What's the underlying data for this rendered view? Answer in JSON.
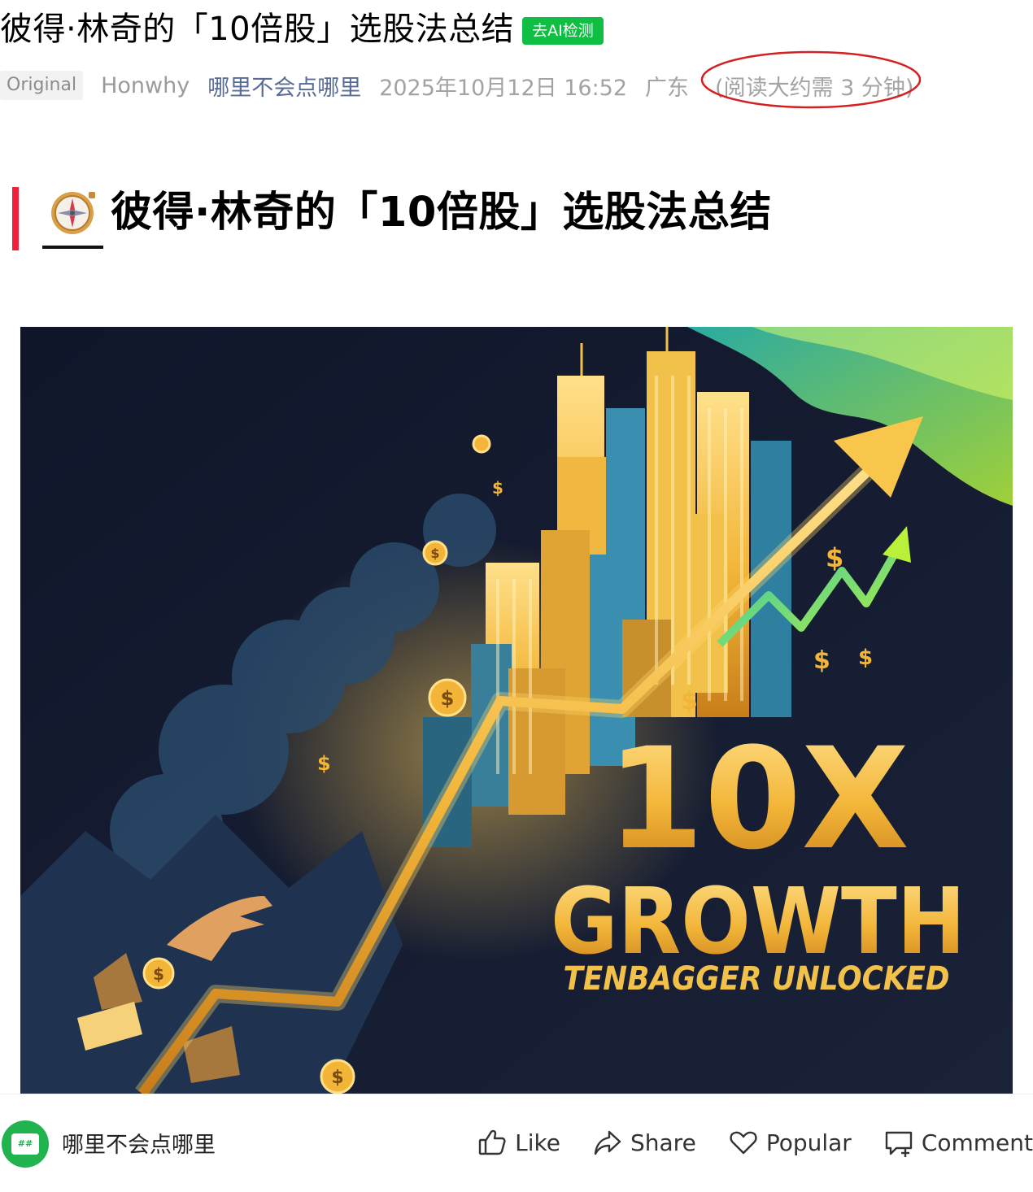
{
  "article": {
    "title": "彼得·林奇的「10倍股」选股法总结",
    "ai_badge": "去AI检测"
  },
  "meta": {
    "original_badge": "Original",
    "author": "Honwhy",
    "account_name": "哪里不会点哪里",
    "publish_time": "2025年10月12日 16:52",
    "region": "广东",
    "reading_time": "(阅读大约需 3 分钟)"
  },
  "section_heading": {
    "icon": "compass-icon",
    "text": "彼得·林奇的「10倍股」选股法总结"
  },
  "hero_image": {
    "headline": "10X",
    "subheadline": "GROWTH",
    "tagline": "TENBAGGER UNLOCKED"
  },
  "bottom_bar": {
    "account_name": "哪里不会点哪里",
    "avatar_text": "##",
    "actions": [
      {
        "icon": "thumbs-up-icon",
        "label": "Like"
      },
      {
        "icon": "share-icon",
        "label": "Share"
      },
      {
        "icon": "heart-icon",
        "label": "Popular"
      },
      {
        "icon": "comment-icon",
        "label": "Comment"
      }
    ]
  },
  "colors": {
    "ai_badge": "#0fbf44",
    "account_link": "#576b95",
    "heading_bar": "#f0203c",
    "annotation_circle": "#d42020",
    "hero_background": "#141a2e",
    "hero_gold": "#f2b538"
  }
}
